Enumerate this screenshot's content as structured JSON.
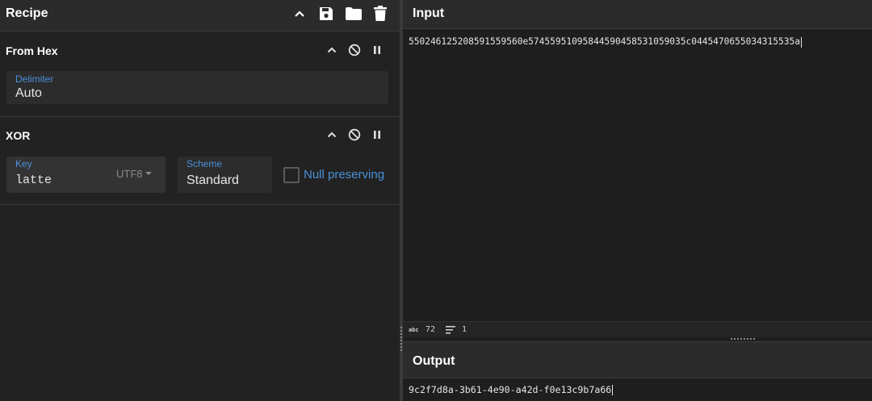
{
  "recipe": {
    "title": "Recipe",
    "operations": [
      {
        "name": "From Hex",
        "delimiter": {
          "label": "Delimiter",
          "value": "Auto"
        }
      },
      {
        "name": "XOR",
        "key": {
          "label": "Key",
          "value": "latte",
          "encoding": "UTF8"
        },
        "scheme": {
          "label": "Scheme",
          "value": "Standard"
        },
        "null_preserving": {
          "label": "Null preserving",
          "checked": false
        }
      }
    ]
  },
  "input": {
    "title": "Input",
    "text": "550246125208591559560e574559510958445904585310590 35c0445470655034315535a",
    "char_count": "72",
    "line_count": "1"
  },
  "output": {
    "title": "Output",
    "text": "9c2f7d8a-3b61-4e90-a42d-f0e13c9b7a66"
  },
  "icons": {
    "chevron_up": "chevron-up-icon",
    "save": "save-icon",
    "folder": "folder-icon",
    "trash": "trash-icon",
    "disable": "disable-icon",
    "pause": "pause-icon"
  }
}
